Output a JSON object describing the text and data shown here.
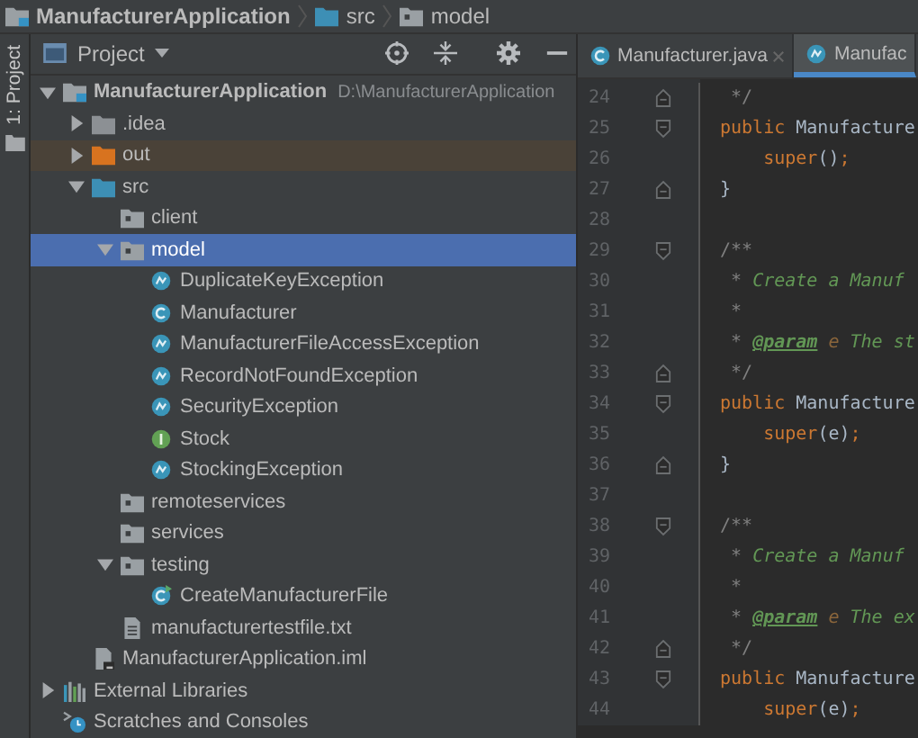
{
  "breadcrumb": [
    {
      "label": "ManufacturerApplication",
      "kind": "project"
    },
    {
      "label": "src",
      "kind": "source-folder"
    },
    {
      "label": "model",
      "kind": "package"
    }
  ],
  "tool_strip": {
    "label": "1: Project"
  },
  "project_panel": {
    "title": "Project"
  },
  "tabs": [
    {
      "label": "Manufacturer.java",
      "kind": "class",
      "selected": false,
      "closable": true
    },
    {
      "label": "Manufac",
      "kind": "exception",
      "selected": true,
      "closable": false
    }
  ],
  "tree": [
    {
      "label": "ManufacturerApplication",
      "path": "D:\\ManufacturerApplication",
      "kind": "project",
      "expanded": true,
      "selected": false,
      "children": [
        {
          "label": ".idea",
          "kind": "folder",
          "expanded": false,
          "selected": false
        },
        {
          "label": "out",
          "kind": "excluded-folder",
          "expanded": false,
          "selected": false
        },
        {
          "label": "src",
          "kind": "source-folder",
          "expanded": true,
          "selected": false,
          "children": [
            {
              "label": "client",
              "kind": "package",
              "selected": false
            },
            {
              "label": "model",
              "kind": "package",
              "expanded": true,
              "selected": true,
              "children": [
                {
                  "label": "DuplicateKeyException",
                  "kind": "exception",
                  "selected": false
                },
                {
                  "label": "Manufacturer",
                  "kind": "class",
                  "selected": false
                },
                {
                  "label": "ManufacturerFileAccessException",
                  "kind": "exception",
                  "selected": false
                },
                {
                  "label": "RecordNotFoundException",
                  "kind": "exception",
                  "selected": false
                },
                {
                  "label": "SecurityException",
                  "kind": "exception",
                  "selected": false
                },
                {
                  "label": "Stock",
                  "kind": "interface",
                  "selected": false
                },
                {
                  "label": "StockingException",
                  "kind": "exception",
                  "selected": false
                }
              ]
            },
            {
              "label": "remoteservices",
              "kind": "package",
              "selected": false
            },
            {
              "label": "services",
              "kind": "package",
              "selected": false
            },
            {
              "label": "testing",
              "kind": "package",
              "expanded": true,
              "selected": false,
              "children": [
                {
                  "label": "CreateManufacturerFile",
                  "kind": "runnable-class",
                  "selected": false
                }
              ]
            },
            {
              "label": "manufacturertestfile.txt",
              "kind": "text-file",
              "selected": false
            }
          ]
        },
        {
          "label": "ManufacturerApplication.iml",
          "kind": "module-file",
          "selected": false
        }
      ]
    },
    {
      "label": "External Libraries",
      "kind": "libraries",
      "expanded": false,
      "selected": false
    },
    {
      "label": "Scratches and Consoles",
      "kind": "scratches",
      "selected": false
    }
  ],
  "editor": {
    "lines": [
      {
        "number": "24",
        "fold_start": false,
        "fold_end": true,
        "kind": "doc",
        "tokens": [
          {
            "text": "*/",
            "kind": "comment"
          }
        ]
      },
      {
        "number": "25",
        "fold_start": true,
        "fold_end": false,
        "kind": "member",
        "tokens": [
          {
            "text": "public",
            "kind": "keyword"
          },
          {
            "text": " Manufacture",
            "kind": "plain"
          }
        ]
      },
      {
        "number": "26",
        "fold_start": false,
        "fold_end": false,
        "kind": "body",
        "tokens": [
          {
            "text": "super",
            "kind": "keyword"
          },
          {
            "text": "()",
            "kind": "plain"
          },
          {
            "text": ";",
            "kind": "keyword"
          }
        ]
      },
      {
        "number": "27",
        "fold_start": false,
        "fold_end": true,
        "kind": "member",
        "tokens": [
          {
            "text": "}",
            "kind": "plain"
          }
        ]
      },
      {
        "number": "28",
        "fold_start": false,
        "fold_end": false
      },
      {
        "number": "29",
        "fold_start": true,
        "fold_end": false,
        "kind": "member",
        "tokens": [
          {
            "text": "/**",
            "kind": "comment"
          }
        ]
      },
      {
        "number": "30",
        "fold_start": false,
        "fold_end": false,
        "kind": "doc",
        "tokens": [
          {
            "text": "*",
            "kind": "comment"
          },
          {
            "text": " Create a Manuf",
            "kind": "doc"
          }
        ]
      },
      {
        "number": "31",
        "fold_start": false,
        "fold_end": false,
        "kind": "doc",
        "tokens": [
          {
            "text": "*",
            "kind": "comment"
          }
        ]
      },
      {
        "number": "32",
        "fold_start": false,
        "fold_end": false,
        "kind": "doc",
        "tokens": [
          {
            "text": "*",
            "kind": "comment"
          },
          {
            "text": "@param",
            "kind": "doc-tag"
          },
          {
            "text": " e",
            "kind": "doc-param"
          },
          {
            "text": " The st",
            "kind": "doc"
          }
        ]
      },
      {
        "number": "33",
        "fold_start": false,
        "fold_end": true,
        "kind": "doc",
        "tokens": [
          {
            "text": "*/",
            "kind": "comment"
          }
        ]
      },
      {
        "number": "34",
        "fold_start": true,
        "fold_end": false,
        "kind": "member",
        "tokens": [
          {
            "text": "public",
            "kind": "keyword"
          },
          {
            "text": " Manufacture",
            "kind": "plain"
          }
        ]
      },
      {
        "number": "35",
        "fold_start": false,
        "fold_end": false,
        "kind": "body",
        "tokens": [
          {
            "text": "super",
            "kind": "keyword"
          },
          {
            "text": "(e)",
            "kind": "plain"
          },
          {
            "text": ";",
            "kind": "keyword"
          }
        ]
      },
      {
        "number": "36",
        "fold_start": false,
        "fold_end": true,
        "kind": "member",
        "tokens": [
          {
            "text": "}",
            "kind": "plain"
          }
        ]
      },
      {
        "number": "37",
        "fold_start": false,
        "fold_end": false
      },
      {
        "number": "38",
        "fold_start": true,
        "fold_end": false,
        "kind": "member",
        "tokens": [
          {
            "text": "/**",
            "kind": "comment"
          }
        ]
      },
      {
        "number": "39",
        "fold_start": false,
        "fold_end": false,
        "kind": "doc",
        "tokens": [
          {
            "text": "*",
            "kind": "comment"
          },
          {
            "text": " Create a Manuf",
            "kind": "doc"
          }
        ]
      },
      {
        "number": "40",
        "fold_start": false,
        "fold_end": false,
        "kind": "doc",
        "tokens": [
          {
            "text": "*",
            "kind": "comment"
          }
        ]
      },
      {
        "number": "41",
        "fold_start": false,
        "fold_end": false,
        "kind": "doc",
        "tokens": [
          {
            "text": "*",
            "kind": "comment"
          },
          {
            "text": "@param",
            "kind": "doc-tag"
          },
          {
            "text": " e",
            "kind": "doc-param"
          },
          {
            "text": " The ex",
            "kind": "doc"
          }
        ]
      },
      {
        "number": "42",
        "fold_start": false,
        "fold_end": true,
        "kind": "doc",
        "tokens": [
          {
            "text": "*/",
            "kind": "comment"
          }
        ]
      },
      {
        "number": "43",
        "fold_start": true,
        "fold_end": false,
        "kind": "member",
        "tokens": [
          {
            "text": "public",
            "kind": "keyword"
          },
          {
            "text": " Manufacture",
            "kind": "plain"
          }
        ]
      },
      {
        "number": "44",
        "fold_start": false,
        "fold_end": false,
        "kind": "body",
        "tokens": [
          {
            "text": "super",
            "kind": "keyword"
          },
          {
            "text": "(e)",
            "kind": "plain"
          },
          {
            "text": ";",
            "kind": "keyword"
          }
        ]
      }
    ]
  }
}
